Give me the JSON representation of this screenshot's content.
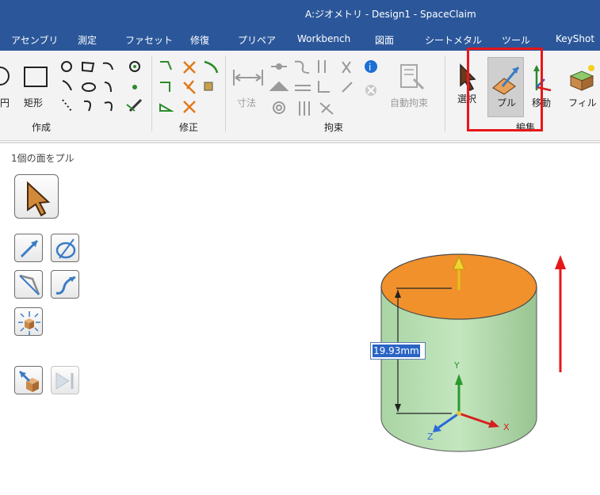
{
  "window": {
    "title": "A:ジオメトリ - Design1 - SpaceClaim"
  },
  "menu": {
    "items": [
      "アセンブリ",
      "測定",
      "ファセット",
      "修復",
      "プリペア",
      "Workbench",
      "図面",
      "シートメタル",
      "ツール",
      "KeyShot"
    ]
  },
  "ribbon": {
    "groups": {
      "create": "作成",
      "modify": "修正",
      "constraint": "拘束",
      "edit": "編集"
    },
    "tools": {
      "rectangle": "矩形",
      "dimension": "寸法",
      "auto_constraint": "自動拘束",
      "select": "選択",
      "pull": "プル",
      "move": "移動",
      "fill": "フィル",
      "partial_left": "円"
    }
  },
  "panel": {
    "title": "1個の面をプル"
  },
  "viewport": {
    "dimension_value": "19.93mm",
    "axis_labels": {
      "x": "X",
      "y": "Y",
      "z": "Z"
    }
  },
  "colors": {
    "title_bar": "#2b579a",
    "face_top": "#f0912c",
    "cylinder_body": "#b7ddb2",
    "highlight": "#e8161a"
  }
}
